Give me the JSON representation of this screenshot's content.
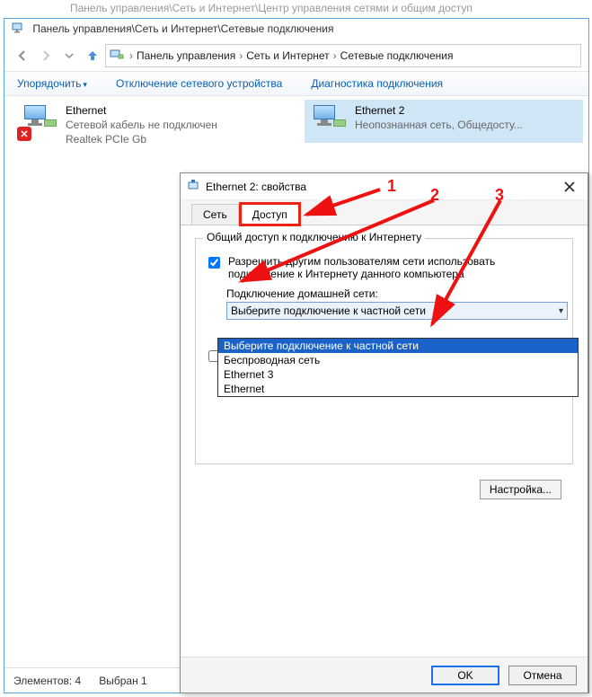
{
  "ghost_title": "Панель управления\\Сеть и Интернет\\Центр управления сетями и общим доступ",
  "explorer": {
    "title": "Панель управления\\Сеть и Интернет\\Сетевые подключения",
    "breadcrumbs": {
      "c0": "Панель управления",
      "c1": "Сеть и Интернет",
      "c2": "Сетевые подключения"
    },
    "toolbar": {
      "organize": "Упорядочить",
      "disable": "Отключение сетевого устройства",
      "diagnose": "Диагностика подключения"
    },
    "items": {
      "left": {
        "name": "Ethernet",
        "line2": "Сетевой кабель не подключен",
        "line3": "Realtek PCIe Gb"
      },
      "right": {
        "name": "Ethernet 2",
        "line2": "Неопознанная сеть, Общедосту..."
      }
    },
    "status": {
      "elements": "Элементов: 4",
      "selected": "Выбран 1"
    }
  },
  "dialog": {
    "title": "Ethernet 2: свойства",
    "tabs": {
      "net": "Сеть",
      "share": "Доступ"
    },
    "group_legend": "Общий доступ к подключению к Интернету",
    "chk1": "Разрешить другим пользователям сети использовать подключение к Интернету данного компьютера",
    "home_label": "Подключение домашней сети:",
    "combo_value": "Выберите подключение к частной сети",
    "options": {
      "o0": "Выберите подключение к частной сети",
      "o1": "Беспроводная сеть",
      "o2": "Ethernet 3",
      "o3": "Ethernet"
    },
    "chk2_partial": "",
    "cfg_btn": "Настройка...",
    "ok": "OK",
    "cancel": "Отмена"
  },
  "annotations": {
    "a1": "1",
    "a2": "2",
    "a3": "3"
  }
}
